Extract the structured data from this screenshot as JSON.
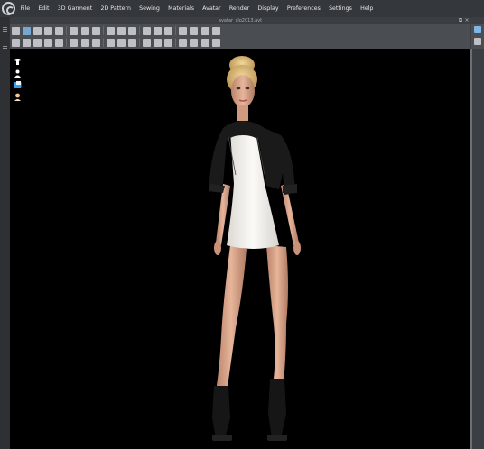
{
  "app": {
    "logo_name": "clo-logo"
  },
  "menu": [
    "File",
    "Edit",
    "3D Garment",
    "2D Pattern",
    "Sewing",
    "Materials",
    "Avatar",
    "Render",
    "Display",
    "Preferences",
    "Settings",
    "Help"
  ],
  "document": {
    "title": "avatar_clo2013.avt"
  },
  "window_controls": {
    "restore": "⧉",
    "close": "×"
  },
  "viewport_tools": [
    {
      "name": "garment-display-icon",
      "color": "#ffffff"
    },
    {
      "name": "avatar-display-icon",
      "color": "#ffffff"
    },
    {
      "name": "texture-display-icon",
      "color": "#3aa0e8"
    },
    {
      "name": "avatar-skin-icon",
      "color": "#f2c69b"
    }
  ],
  "colors": {
    "viewport_bg": "#000000",
    "toolbar_bg": "#4a4d52",
    "menubar_bg": "#34373b",
    "jacket": "#1a1a1a",
    "dress": "#f4f2ee",
    "skin": "#d9a487",
    "hair": "#d8b878"
  }
}
